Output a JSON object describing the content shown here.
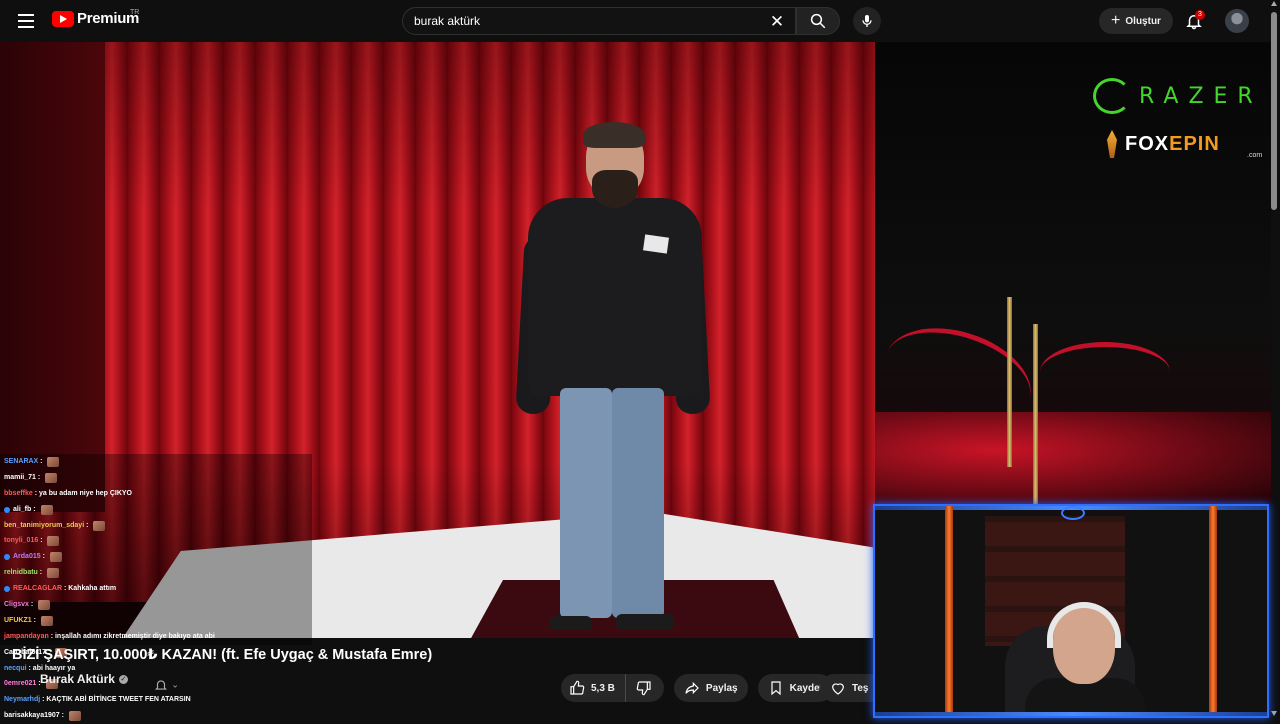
{
  "header": {
    "logo_text": "Premium",
    "country_code": "TR",
    "search_value": "burak aktürk",
    "create_label": "Oluştur",
    "notification_count": "3"
  },
  "overlay": {
    "sponsor_razer": "RAZER",
    "sponsor_fox_a": "FOX",
    "sponsor_fox_b": "EPIN",
    "sponsor_fox_domain": ".com"
  },
  "chat": {
    "messages": [
      {
        "user": "SENARAX",
        "color": "#5aa0ff",
        "text": "",
        "emote": true
      },
      {
        "user": "mamii_71",
        "color": "#ffffff",
        "text": "",
        "emote": true
      },
      {
        "user": "bbseffke",
        "color": "#ff5a5a",
        "text": "ya bu adam niye hep ÇIKYO",
        "emote": false
      },
      {
        "user": "ali_fb",
        "color": "#ffffff",
        "text": "",
        "emote": true,
        "icon": true
      },
      {
        "user": "ben_tanimiyorum_sdayi",
        "color": "#f2c94c",
        "text": "",
        "emote": true
      },
      {
        "user": "tonyli_016",
        "color": "#ff5a5a",
        "text": "",
        "emote": true
      },
      {
        "user": "Arda015",
        "color": "#c07aff",
        "text": "",
        "emote": true,
        "icon": true
      },
      {
        "user": "relnidbatu",
        "color": "#9be36a",
        "text": "",
        "emote": true
      },
      {
        "user": "REALCAGLAR",
        "color": "#ff5a5a",
        "text": "Kahkaha attım",
        "emote": false,
        "icon": true
      },
      {
        "user": "Cligsvx",
        "color": "#ff7ad9",
        "text": "",
        "emote": true
      },
      {
        "user": "UFUKZ1",
        "color": "#f2c94c",
        "text": "",
        "emote": true
      },
      {
        "user": "jampandayan",
        "color": "#ff5a5a",
        "text": "inşallah adımı zikretmemiştir diye bakıyo ata abi",
        "emote": false
      },
      {
        "user": "Can_balor17",
        "color": "#ffffff",
        "text": "",
        "emote": true
      },
      {
        "user": "necqui",
        "color": "#5aa0ff",
        "text": "abi haayır ya",
        "emote": false
      },
      {
        "user": "0emre021",
        "color": "#ff7ad9",
        "text": "",
        "emote": true
      },
      {
        "user": "Neymarhdj",
        "color": "#5aa0ff",
        "text": "KAÇTIK ABİ BİTİNCE TWEET FEN ATARSIN",
        "emote": false
      },
      {
        "user": "barisakkaya1907",
        "color": "#ffffff",
        "text": "",
        "emote": true
      }
    ]
  },
  "video": {
    "title": "BİZİ ŞAŞIRT, 10.000₺ KAZAN! (ft. Efe Uygaç & Mustafa Emre)",
    "channel": "Burak Aktürk",
    "like_count": "5,3 B",
    "share_label": "Paylaş",
    "save_label": "Kaydet",
    "clip_label": "Teş"
  },
  "colors": {
    "accent_red": "#ff0000",
    "razer_green": "#44d62c",
    "foxepin_orange": "#f29b1e",
    "webcam_border": "#2d6fff"
  }
}
